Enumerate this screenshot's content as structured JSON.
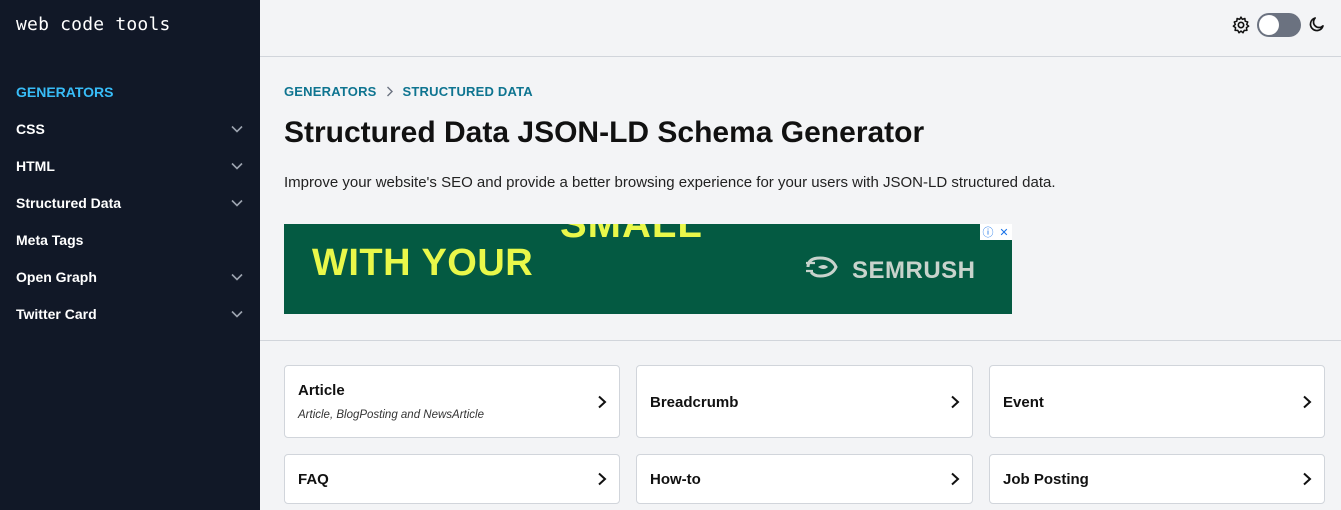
{
  "app": {
    "logo": "web code tools"
  },
  "sidebar": {
    "section_label": "GENERATORS",
    "items": [
      {
        "label": "CSS",
        "has_chevron": true
      },
      {
        "label": "HTML",
        "has_chevron": true
      },
      {
        "label": "Structured Data",
        "has_chevron": true
      },
      {
        "label": "Meta Tags",
        "has_chevron": false
      },
      {
        "label": "Open Graph",
        "has_chevron": true
      },
      {
        "label": "Twitter Card",
        "has_chevron": true
      }
    ]
  },
  "header": {
    "icons": [
      "gear-icon",
      "moon-icon"
    ],
    "theme_toggle": "off"
  },
  "breadcrumb": {
    "items": [
      "GENERATORS",
      "STRUCTURED DATA"
    ]
  },
  "main": {
    "title": "Structured Data JSON-LD Schema Generator",
    "description": "Improve your website's SEO and provide a better browsing experience for your users with JSON-LD structured data."
  },
  "ad": {
    "headline_top": "SMALL",
    "headline": "WITH YOUR",
    "brand": "SEMRUSH",
    "badge_info": "ⓘ",
    "badge_close": "✕",
    "colors": {
      "background": "#045a42",
      "text": "#e9f84a"
    }
  },
  "cards": [
    {
      "title": "Article",
      "subtitle": "Article, BlogPosting and NewsArticle"
    },
    {
      "title": "Breadcrumb",
      "subtitle": ""
    },
    {
      "title": "Event",
      "subtitle": ""
    },
    {
      "title": "FAQ",
      "subtitle": ""
    },
    {
      "title": "How-to",
      "subtitle": ""
    },
    {
      "title": "Job Posting",
      "subtitle": ""
    }
  ],
  "colors": {
    "sidebar_bg": "#111827",
    "accent": "#38bdf8",
    "breadcrumb": "#0e7490",
    "page_bg": "#f3f4f6"
  }
}
